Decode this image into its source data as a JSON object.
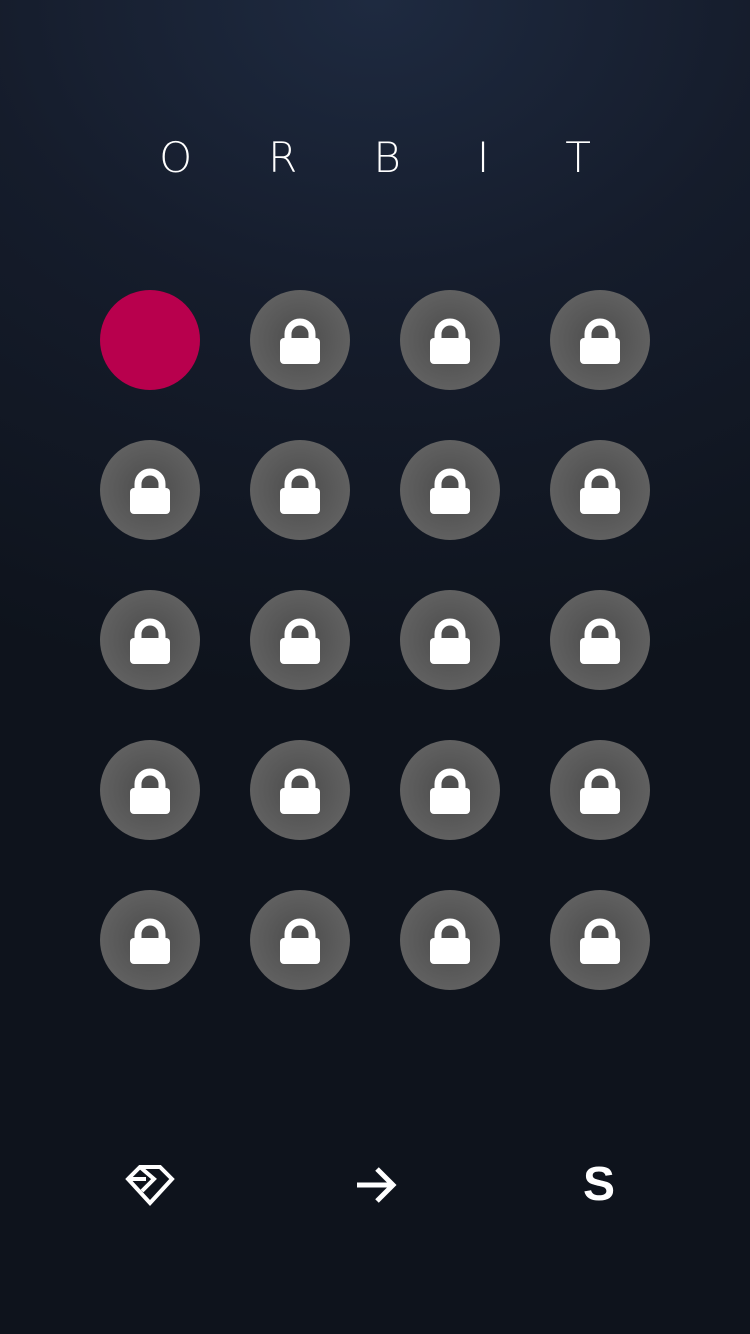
{
  "title": "ORBIT",
  "colors": {
    "current_level": "#b8004d",
    "locked_level": "#5a5a5a",
    "lock_icon": "#ffffff",
    "background_top": "#1e2a40",
    "background_bottom": "#0e131c"
  },
  "levels": [
    {
      "state": "current"
    },
    {
      "state": "locked",
      "icon": "lock-icon"
    },
    {
      "state": "locked",
      "icon": "lock-icon"
    },
    {
      "state": "locked",
      "icon": "lock-icon"
    },
    {
      "state": "locked",
      "icon": "lock-icon"
    },
    {
      "state": "locked",
      "icon": "lock-icon"
    },
    {
      "state": "locked",
      "icon": "lock-icon"
    },
    {
      "state": "locked",
      "icon": "lock-icon"
    },
    {
      "state": "locked",
      "icon": "lock-icon"
    },
    {
      "state": "locked",
      "icon": "lock-icon"
    },
    {
      "state": "locked",
      "icon": "lock-icon"
    },
    {
      "state": "locked",
      "icon": "lock-icon"
    },
    {
      "state": "locked",
      "icon": "lock-icon"
    },
    {
      "state": "locked",
      "icon": "lock-icon"
    },
    {
      "state": "locked",
      "icon": "lock-icon"
    },
    {
      "state": "locked",
      "icon": "lock-icon"
    },
    {
      "state": "locked",
      "icon": "lock-icon"
    },
    {
      "state": "locked",
      "icon": "lock-icon"
    },
    {
      "state": "locked",
      "icon": "lock-icon"
    },
    {
      "state": "locked",
      "icon": "lock-icon"
    }
  ],
  "bottom_bar": {
    "left_icon": "diamond-icon",
    "center_icon": "arrow-right-icon",
    "right_label": "S"
  }
}
